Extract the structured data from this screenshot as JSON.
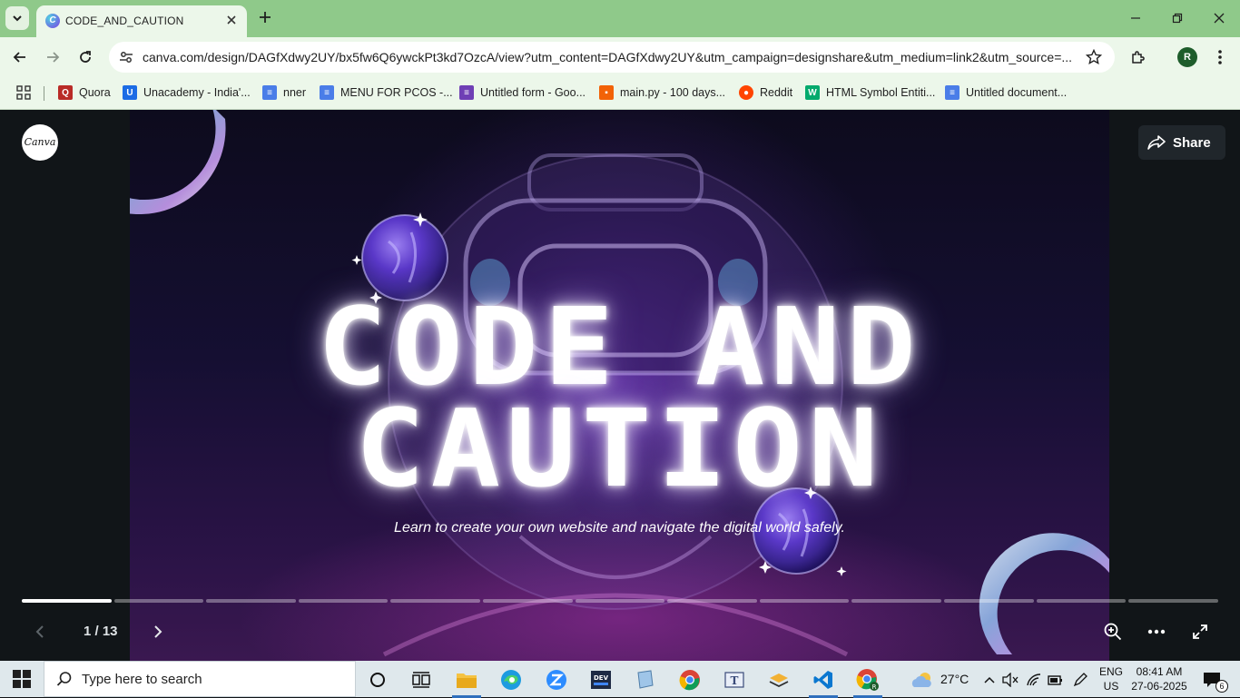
{
  "browser": {
    "tab_title": "CODE_AND_CAUTION",
    "url": "canva.com/design/DAGfXdwy2UY/bx5fw6Q6ywckPt3kd7OzcA/view?utm_content=DAGfXdwy2UY&utm_campaign=designshare&utm_medium=link2&utm_source=...",
    "profile_initial": "R",
    "bookmarks": [
      {
        "label": "Quora",
        "icon": "quora-icon",
        "color": "#b92b27"
      },
      {
        "label": "Unacademy - India'...",
        "icon": "unacademy-icon",
        "color": "#1c6ce5"
      },
      {
        "label": "nner",
        "icon": "docs-icon",
        "color": "#4a7de8"
      },
      {
        "label": "MENU FOR PCOS -...",
        "icon": "docs-icon",
        "color": "#4a7de8"
      },
      {
        "label": "Untitled form - Goo...",
        "icon": "forms-icon",
        "color": "#6f3fb5"
      },
      {
        "label": "main.py - 100 days...",
        "icon": "replit-icon",
        "color": "#f26207"
      },
      {
        "label": "Reddit",
        "icon": "reddit-icon",
        "color": "#ff4500"
      },
      {
        "label": "HTML Symbol Entiti...",
        "icon": "w3schools-icon",
        "color": "#04aa6d"
      },
      {
        "label": "Untitled document...",
        "icon": "docs-icon",
        "color": "#4a7de8"
      }
    ]
  },
  "viewer": {
    "logo_text": "Canva",
    "share_label": "Share",
    "slide": {
      "title_line1": "CODE AND",
      "title_line2": "CAUTION",
      "subtitle": "Learn to create your own website and navigate the digital world safely."
    },
    "page_indicator": "1 / 13",
    "current_page": 1,
    "total_pages": 13
  },
  "taskbar": {
    "search_placeholder": "Type here to search",
    "weather": "27°C",
    "language": "ENG",
    "region": "US",
    "time": "08:41 AM",
    "date": "27-06-2025",
    "notification_count": "6",
    "accent": "#2f6fbd"
  }
}
